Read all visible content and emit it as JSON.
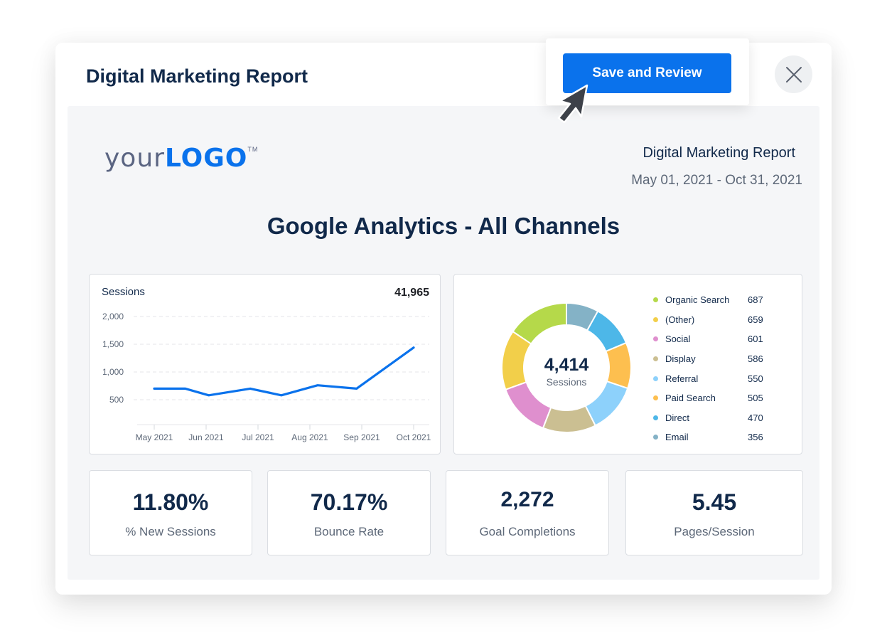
{
  "modal": {
    "title": "Digital Marketing Report",
    "save_button_label": "Save and Review",
    "close_icon": "close-icon",
    "cursor_icon": "mouse-pointer-icon"
  },
  "report": {
    "logo": {
      "prefix": "your",
      "brand": "LOGO",
      "trademark": "TM"
    },
    "name": "Digital Marketing Report",
    "date_range": "May 01, 2021 - Oct 31, 2021",
    "section_title": "Google Analytics - All Channels"
  },
  "sessions_card": {
    "label": "Sessions",
    "total": "41,965"
  },
  "channels_card": {
    "center_value": "4,414",
    "center_label": "Sessions"
  },
  "kpis": [
    {
      "value": "11.80%",
      "label": "% New Sessions"
    },
    {
      "value": "70.17%",
      "label": "Bounce Rate"
    },
    {
      "value": "2,272",
      "label": "Goal Completions"
    },
    {
      "value": "5.45",
      "label": "Pages/Session"
    }
  ],
  "chart_data": [
    {
      "type": "line",
      "title": "Sessions",
      "total": "41,965",
      "xlabel": "",
      "ylabel": "",
      "x_tick_labels": [
        "May 2021",
        "Jun 2021",
        "Jul 2021",
        "Aug 2021",
        "Sep 2021",
        "Oct 2021"
      ],
      "y_tick_labels": [
        "2,000",
        "1,500",
        "1,000",
        "500"
      ],
      "y_ticks": [
        2000,
        1500,
        1000,
        500
      ],
      "ylim": [
        0,
        2100
      ],
      "grid": true,
      "series": [
        {
          "name": "Sessions",
          "color": "#0a72ec",
          "x": [
            0,
            0.6,
            1.05,
            1.85,
            2.45,
            3.15,
            3.9,
            5.0
          ],
          "values": [
            700,
            700,
            580,
            700,
            580,
            760,
            700,
            1440
          ]
        }
      ]
    },
    {
      "type": "pie",
      "variant": "donut",
      "center_value": "4,414",
      "center_label": "Sessions",
      "legend": "right",
      "slices": [
        {
          "label": "Organic Search",
          "value": 687,
          "color": "#b5d94a"
        },
        {
          "label": "(Other)",
          "value": 659,
          "color": "#f2cf4a"
        },
        {
          "label": "Social",
          "value": 601,
          "color": "#df8fce"
        },
        {
          "label": "Display",
          "value": 586,
          "color": "#cbbf92"
        },
        {
          "label": "Referral",
          "value": 550,
          "color": "#8dd1fb"
        },
        {
          "label": "Paid Search",
          "value": 505,
          "color": "#fdbf4f"
        },
        {
          "label": "Direct",
          "value": 470,
          "color": "#4db7e8"
        },
        {
          "label": "Email",
          "value": 356,
          "color": "#84b2c6"
        }
      ]
    }
  ],
  "colors": {
    "accent": "#0a72ec",
    "text_dark": "#11294a",
    "text_muted": "#5d6878",
    "report_bg": "#f5f6f8"
  }
}
